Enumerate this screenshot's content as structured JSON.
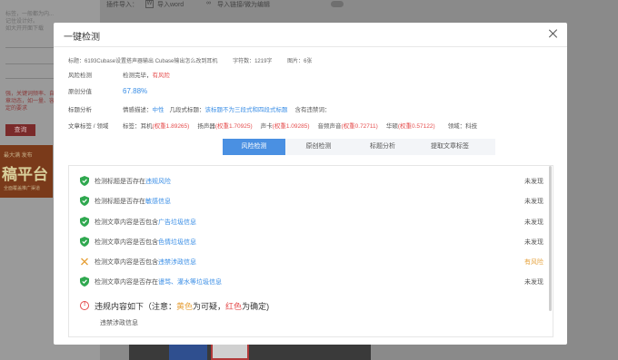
{
  "background": {
    "left_lines": [
      "标签，一般都为内...",
      "记住设计好。",
      "如大开开面下载"
    ],
    "warning": "强，关键词频率、自",
    "warning2": "章动态，如一量、容",
    "warning3": "定的要求",
    "search_btn": "查询",
    "ad_title": "最大满 发布",
    "ad_brand": "稿平台",
    "ad_sub": "全面覆盖推广渠道",
    "toolbar_label": "插件导入：",
    "import_word": "导入word",
    "import_link": "导入链接/微为编辑"
  },
  "modal": {
    "title": "一键检测",
    "meta": {
      "title_line": "标题：6193Cubase设置搭声器输出 Cubase输出怎么改到耳机",
      "char_count": "字符数：1219字",
      "images": "图片：6张"
    },
    "risk": {
      "label": "风险检测",
      "text": "检测完毕，",
      "status": "有风险"
    },
    "score": {
      "label": "原创分值",
      "value": "67.88%"
    },
    "analysis": {
      "label": "标题分析",
      "sentiment_label": "情感描述：",
      "sentiment_value": "中性",
      "para_label": "几段式标题：",
      "para_value": "该标题不为三段式和四段式标题",
      "banned_label": "含有违禁词："
    },
    "tags": {
      "label": "文章标签 / 领域",
      "prefix": "标签：",
      "items": [
        {
          "name": "耳机",
          "weight": "(权重1.89265)"
        },
        {
          "name": "扬声器",
          "weight": "(权重1.70925)"
        },
        {
          "name": "声卡",
          "weight": "(权重1.09285)"
        },
        {
          "name": "音频声音",
          "weight": "(权重0.72711)"
        },
        {
          "name": "华硕",
          "weight": "(权重0.57122)"
        }
      ],
      "domain_label": "领域：",
      "domain_value": "科技"
    },
    "tabs": [
      "风险检测",
      "原创检测",
      "标题分析",
      "提取文章标签"
    ],
    "checks": [
      {
        "prefix": "检测标题是否存在",
        "keyword": "违规风险",
        "status": "未发现",
        "icon": "shield-check-icon"
      },
      {
        "prefix": "检测标题是否存在",
        "keyword": "敏感信息",
        "status": "未发现",
        "icon": "shield-check-icon"
      },
      {
        "prefix": "检测文章内容是否包含",
        "keyword": "广告垃圾信息",
        "status": "未发现",
        "icon": "shield-check-icon"
      },
      {
        "prefix": "检测文章内容是否包含",
        "keyword": "色情垃圾信息",
        "status": "未发现",
        "icon": "shield-check-icon"
      },
      {
        "prefix": "检测文章内容是否包含",
        "keyword": "违禁涉政信息",
        "status": "有风险",
        "icon": "warning-cross-icon"
      },
      {
        "prefix": "检测文章内容是否存在",
        "keyword": "谩骂、灌水等垃圾信息",
        "status": "未发现",
        "icon": "shield-check-icon"
      }
    ],
    "summary": {
      "lead": "违规内容如下（注意：",
      "yellow": "黄色",
      "mid": "为可疑，",
      "red": "红色",
      "tail": "为确定)"
    },
    "sub_category": "违禁涉政信息"
  },
  "colors": {
    "accent": "#4a90e2",
    "danger": "#e54e4e",
    "warn": "#e6a23c",
    "ok": "#2fa84f"
  }
}
